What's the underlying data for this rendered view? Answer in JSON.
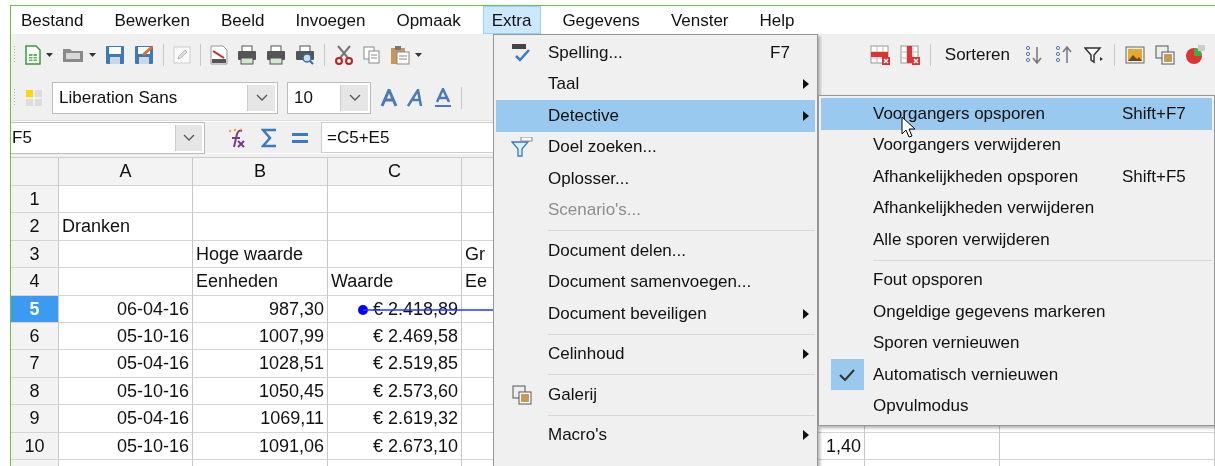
{
  "menubar": [
    {
      "label": "Bestand",
      "selected": false
    },
    {
      "label": "Bewerken",
      "selected": false
    },
    {
      "label": "Beeld",
      "selected": false
    },
    {
      "label": "Invoegen",
      "selected": false
    },
    {
      "label": "Opmaak",
      "selected": false
    },
    {
      "label": "Extra",
      "selected": true
    },
    {
      "label": "Gegevens",
      "selected": false
    },
    {
      "label": "Venster",
      "selected": false
    },
    {
      "label": "Help",
      "selected": false
    }
  ],
  "sort_button": "Sorteren",
  "font_name": "Liberation Sans",
  "font_size": "10",
  "name_box": "F5",
  "formula": "=C5+E5",
  "sheet": {
    "columns": [
      "A",
      "B",
      "C"
    ],
    "rows": [
      {
        "number": "1",
        "selected": false,
        "cells": []
      },
      {
        "number": "2",
        "selected": false,
        "cells": [
          {
            "text": "Dranken",
            "kind": "text"
          }
        ]
      },
      {
        "number": "3",
        "selected": false,
        "cells": [
          null,
          {
            "text": "Hoge waarde",
            "kind": "text"
          },
          null,
          {
            "text": "Gr",
            "kind": "text"
          }
        ]
      },
      {
        "number": "4",
        "selected": false,
        "cells": [
          null,
          {
            "text": "Eenheden",
            "kind": "text"
          },
          {
            "text": "Waarde",
            "kind": "text"
          },
          {
            "text": "Ee",
            "kind": "text"
          }
        ]
      },
      {
        "number": "5",
        "selected": true,
        "trace_arrow": true,
        "cells": [
          {
            "text": "06-04-16",
            "kind": "number"
          },
          {
            "text": "987,30",
            "kind": "number"
          },
          {
            "text": "€ 2.418,89",
            "kind": "number"
          }
        ]
      },
      {
        "number": "6",
        "selected": false,
        "cells": [
          {
            "text": "05-10-16",
            "kind": "number"
          },
          {
            "text": "1007,99",
            "kind": "number"
          },
          {
            "text": "€ 2.469,58",
            "kind": "number"
          }
        ]
      },
      {
        "number": "7",
        "selected": false,
        "cells": [
          {
            "text": "05-04-16",
            "kind": "number"
          },
          {
            "text": "1028,51",
            "kind": "number"
          },
          {
            "text": "€ 2.519,85",
            "kind": "number"
          }
        ]
      },
      {
        "number": "8",
        "selected": false,
        "cells": [
          {
            "text": "05-10-16",
            "kind": "number"
          },
          {
            "text": "1050,45",
            "kind": "number"
          },
          {
            "text": "€ 2.573,60",
            "kind": "number"
          }
        ]
      },
      {
        "number": "9",
        "selected": false,
        "cells": [
          {
            "text": "05-04-16",
            "kind": "number"
          },
          {
            "text": "1069,11",
            "kind": "number"
          },
          {
            "text": "€ 2.619,32",
            "kind": "number"
          }
        ]
      },
      {
        "number": "10",
        "selected": false,
        "cells": [
          {
            "text": "05-10-16",
            "kind": "number"
          },
          {
            "text": "1091,06",
            "kind": "number"
          },
          {
            "text": "€ 2.673,10",
            "kind": "number"
          },
          null,
          null,
          {
            "text": "1,40",
            "kind": "number"
          }
        ]
      }
    ]
  },
  "extra_menu": {
    "groups": [
      [
        {
          "label": "Spelling...",
          "shortcut": "F7",
          "submenu": false,
          "disabled": false,
          "selected": false
        },
        {
          "label": "Taal",
          "submenu": true,
          "disabled": false,
          "selected": false
        },
        {
          "label": "Detective",
          "submenu": true,
          "disabled": false,
          "selected": true
        },
        {
          "label": "Doel zoeken...",
          "submenu": false,
          "disabled": false,
          "selected": false
        },
        {
          "label": "Oplosser...",
          "submenu": false,
          "disabled": false,
          "selected": false
        },
        {
          "label": "Scenario's...",
          "submenu": false,
          "disabled": true,
          "selected": false
        }
      ],
      [
        {
          "label": "Document delen...",
          "submenu": false,
          "disabled": false,
          "selected": false
        },
        {
          "label": "Document samenvoegen...",
          "submenu": false,
          "disabled": false,
          "selected": false
        },
        {
          "label": "Document beveiligen",
          "submenu": true,
          "disabled": false,
          "selected": false
        }
      ],
      [
        {
          "label": "Celinhoud",
          "submenu": true,
          "disabled": false,
          "selected": false
        }
      ],
      [
        {
          "label": "Galerij",
          "submenu": false,
          "disabled": false,
          "selected": false
        }
      ],
      [
        {
          "label": "Macro's",
          "submenu": true,
          "disabled": false,
          "selected": false
        }
      ]
    ]
  },
  "detective_submenu": {
    "groups": [
      [
        {
          "label": "Voorgangers opsporen",
          "shortcut": "Shift+F7",
          "selected": true,
          "checked": false
        },
        {
          "label": "Voorgangers verwijderen",
          "selected": false,
          "checked": false
        },
        {
          "label": "Afhankelijkheden opsporen",
          "shortcut": "Shift+F5",
          "selected": false,
          "checked": false
        },
        {
          "label": "Afhankelijkheden verwijderen",
          "selected": false,
          "checked": false
        },
        {
          "label": "Alle sporen verwijderen",
          "selected": false,
          "checked": false
        }
      ],
      [
        {
          "label": "Fout opsporen",
          "selected": false,
          "checked": false
        },
        {
          "label": "Ongeldige gegevens markeren",
          "selected": false,
          "checked": false
        },
        {
          "label": "Sporen vernieuwen",
          "selected": false,
          "checked": false
        },
        {
          "label": "Automatisch vernieuwen",
          "selected": false,
          "checked": true
        },
        {
          "label": "Opvulmodus",
          "selected": false,
          "checked": false
        }
      ]
    ]
  }
}
